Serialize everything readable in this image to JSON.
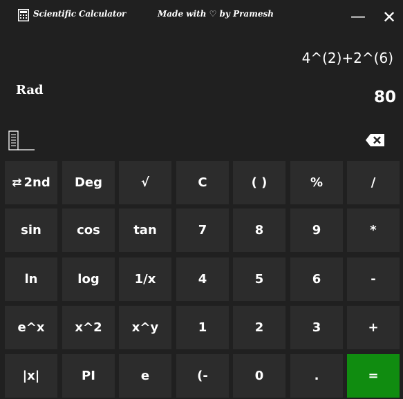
{
  "window": {
    "title": "Scientific Calculator",
    "credit": "Made with ♡ by Pramesh",
    "minimize_label": "—",
    "close_label": "✕"
  },
  "display": {
    "expression": "4^(2)+2^(6)",
    "result": "80",
    "angle_mode": "Rad"
  },
  "icons": {
    "app": "calculator-icon",
    "history": "history-list-icon",
    "backspace": "backspace-icon",
    "swap": "swap-arrows-icon"
  },
  "keypad": {
    "rows": [
      [
        "2nd",
        "Deg",
        "√",
        "C",
        "( )",
        "%",
        "/"
      ],
      [
        "sin",
        "cos",
        "tan",
        "7",
        "8",
        "9",
        "*"
      ],
      [
        "ln",
        "log",
        "1/x",
        "4",
        "5",
        "6",
        "-"
      ],
      [
        "e^x",
        "x^2",
        "x^y",
        "1",
        "2",
        "3",
        "+"
      ],
      [
        "|x|",
        "PI",
        "e",
        "(-",
        "0",
        ".",
        "="
      ]
    ],
    "swap_glyph": "⇄",
    "equals_color": "#108c10"
  },
  "colors": {
    "background": "#202020",
    "key": "#2c2c2c",
    "accent": "#108c10",
    "text": "#ffffff"
  }
}
